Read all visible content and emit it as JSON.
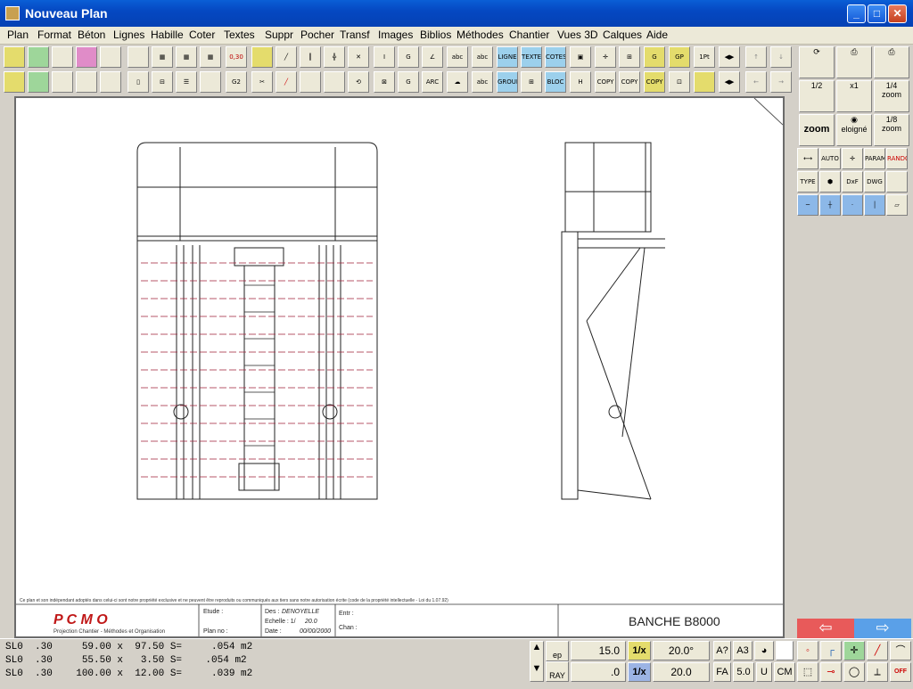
{
  "window": {
    "title": "Nouveau Plan"
  },
  "menu": [
    "Plan",
    "Format",
    "Béton",
    "Lignes",
    "Habille",
    "Coter",
    "Textes",
    "Suppr",
    "Pocher",
    "Transf",
    "Images",
    "Biblios",
    "Méthodes",
    "Chantier",
    "Vues 3D",
    "Calques",
    "Aide"
  ],
  "toolbar": {
    "scale_text": "0,30",
    "row1_texts": [
      "abc",
      "abc",
      "LIGNE",
      "TEXTE",
      "COTES",
      "1Pt"
    ],
    "row2_texts": [
      "ARC",
      "abc",
      "GROUP",
      "BLOC",
      "COPY",
      "COPY",
      "COPY"
    ]
  },
  "right_panel": {
    "zoom_half": "1/2",
    "zoom_x1": "x1",
    "zoom_quarter": "1/4",
    "zoom_label": "zoom",
    "zoom_btn": "zoom",
    "eloigne": "eloigné",
    "zoom_eighth": "1/8",
    "tools_row1": [
      "AUTO",
      "PARAM",
      "RANDO"
    ],
    "tools_row2": [
      "TYPE",
      "DxF",
      "DWG"
    ]
  },
  "titleblock": {
    "company": "P C M O",
    "company_sub": "Projection Chantier - Méthodes et Organisation",
    "etude_label": "Etude :",
    "plan_no_label": "Plan no :",
    "des_label": "Des :",
    "des_value": "DENOYELLE",
    "echelle_label": "Echelle : 1/",
    "echelle_value": "20.0",
    "date_label": "Date :",
    "date_value": "00/00/2000",
    "entr_label": "Entr :",
    "chan_label": "Chan :",
    "title": "BANCHE B8000",
    "legal": "Ce plan et son indépendant adoptés dans celui-ci sont notre propriété exclusive et ne peuvent être reproduits ou communiqués aux tiers sans notre autorisation écrite (code de la propriété intellectuelle - Loi du 1.07.92)"
  },
  "status": {
    "lines": [
      "SL0  .30     59.00 x  97.50 S=     .054 m2",
      "SL0  .30     55.50 x   3.50 S=    .054 m2",
      "SL0  .30    100.00 x  12.00 S=     .039 m2"
    ],
    "ep": "ep",
    "ray": "RAY",
    "val1": "15.0",
    "val2": ".0",
    "ratio1": "1/x",
    "ratio2": "1/x",
    "angle": "20.0°",
    "val3": "20.0",
    "a3": "A3",
    "fa": "FA",
    "fa_val": "5.0",
    "u": "U",
    "cm": "CM",
    "off": "OFF"
  }
}
